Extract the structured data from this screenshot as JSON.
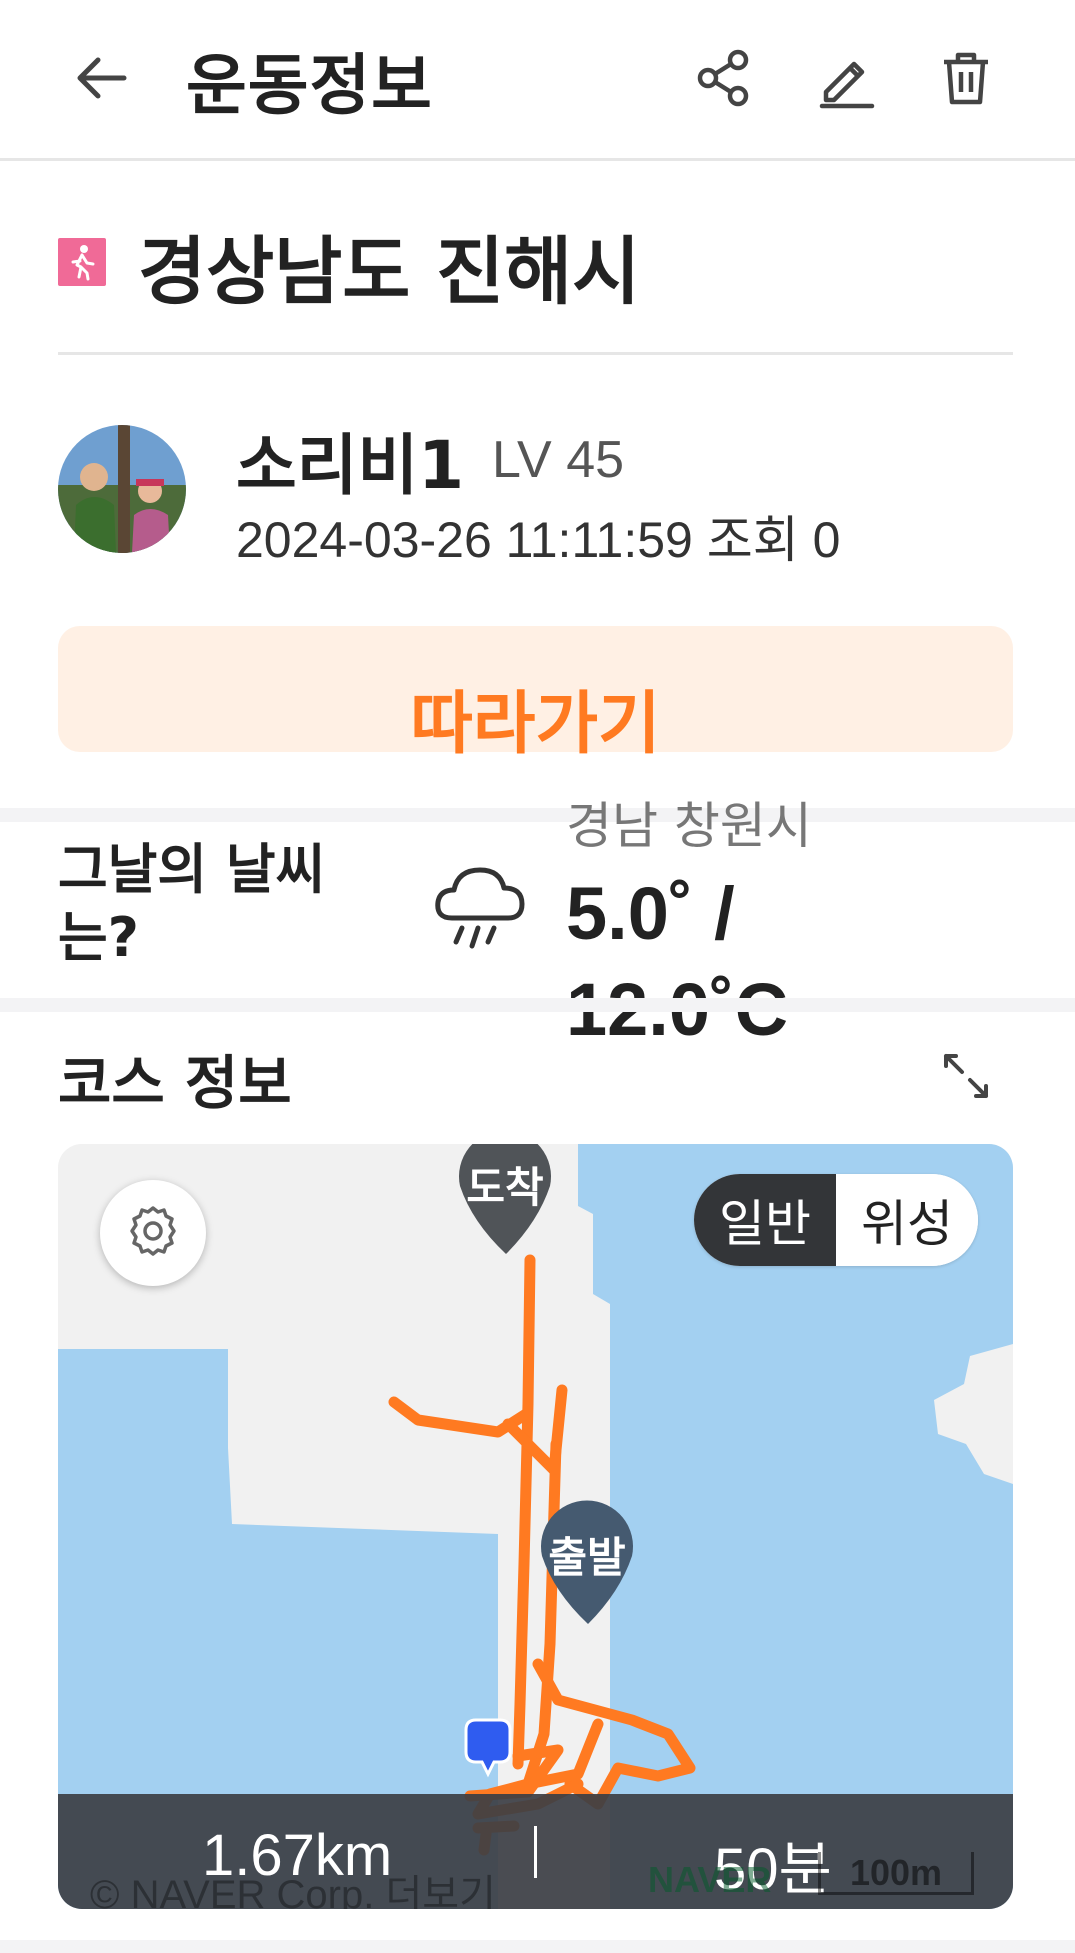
{
  "header": {
    "title": "운동정보",
    "icons": [
      "back-arrow-icon",
      "share-icon",
      "edit-icon",
      "trash-icon"
    ]
  },
  "activity": {
    "type_icon": "walking-person-icon",
    "location": "경상남도 진해시"
  },
  "user": {
    "name": "소리비1",
    "level": "LV 45",
    "meta": "2024-03-26 11:11:59 조회 0"
  },
  "follow": {
    "label": "따라가기"
  },
  "weather": {
    "question": "그날의 날씨는?",
    "icon": "rain-cloud-icon",
    "location": "경남 창원시",
    "temp_line1": "5.0˚ /",
    "temp_line2": "12.0˚C"
  },
  "course": {
    "title": "코스 정보",
    "map": {
      "mode_normal": "일반",
      "mode_satellite": "위성",
      "selected_mode": "일반",
      "start_label": "출발",
      "end_label": "도착",
      "distance": "1.67km",
      "duration": "50분",
      "credit": "© NAVER Corp. 더보기",
      "logo": "NAVER",
      "scale": "100m"
    }
  },
  "colors": {
    "accent": "#ff7a21",
    "follow_bg": "#fff0e4",
    "water": "#a3d0f1",
    "route": "#ff7a21",
    "badge": "#f06a97"
  }
}
